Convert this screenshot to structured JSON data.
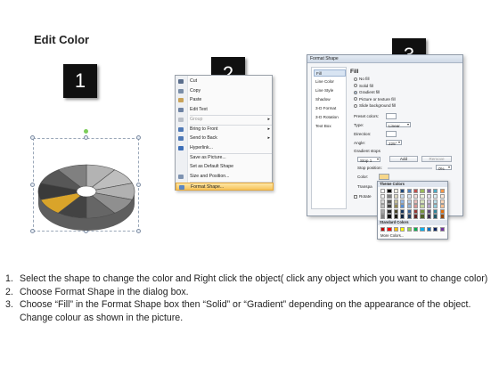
{
  "title": "Edit Color",
  "steps": [
    "1",
    "2",
    "3"
  ],
  "context_menu": {
    "items": [
      {
        "label": "Cut",
        "icon": "scissors-icon",
        "color": "#5a6e8c"
      },
      {
        "label": "Copy",
        "icon": "copy-icon",
        "color": "#7a8ea8"
      },
      {
        "label": "Paste",
        "icon": "paste-icon",
        "color": "#c9a35a"
      },
      {
        "label": "Edit Text",
        "icon": "edit-text-icon",
        "color": "#6d82a3"
      },
      {
        "label": "Group",
        "icon": "group-icon",
        "color": "#b9bfc8",
        "disabled": true,
        "submenu": true
      },
      {
        "label": "Bring to Front",
        "icon": "bring-front-icon",
        "color": "#4f79b6",
        "submenu": true
      },
      {
        "label": "Send to Back",
        "icon": "send-back-icon",
        "color": "#4f79b6",
        "submenu": true
      },
      {
        "label": "Hyperlink...",
        "icon": "hyperlink-icon",
        "color": "#3d6fb8"
      },
      {
        "label": "Save as Picture...",
        "icon": "",
        "color": ""
      },
      {
        "label": "Set as Default Shape",
        "icon": "",
        "color": ""
      },
      {
        "label": "Size and Position...",
        "icon": "size-position-icon",
        "color": "#7e93b0"
      },
      {
        "label": "Format Shape...",
        "icon": "format-shape-icon",
        "color": "#5d86c2",
        "highlighted": true
      }
    ]
  },
  "dialog": {
    "title": "Format Shape",
    "nav": [
      "Fill",
      "Line Color",
      "Line Style",
      "Shadow",
      "3-D Format",
      "3-D Rotation",
      "Text Box"
    ],
    "fill_header": "Fill",
    "radios": [
      "No fill",
      "Solid fill",
      "Gradient fill",
      "Picture or texture fill",
      "Slide background fill"
    ],
    "preset_label": "Preset colors:",
    "type_label": "Type:",
    "type_value": "Linear",
    "direction_label": "Direction:",
    "angle_label": "Angle:",
    "angle_value": "225°",
    "gradient_stops_label": "Gradient stops",
    "stop_value": "Stop 1",
    "add_label": "Add",
    "remove_label": "Remove",
    "stop_position_label": "Stop position:",
    "stop_position_value": "0%",
    "color_label": "Color:",
    "transparency_label": "Transpa",
    "rotate_label": "Rotate"
  },
  "palette": {
    "theme_label": "Theme Colors",
    "standard_label": "Standard Colors",
    "more_label": "More Colors...",
    "theme_top": [
      "#ffffff",
      "#000000",
      "#eeece1",
      "#1f497d",
      "#4f81bd",
      "#c0504d",
      "#9bbb59",
      "#8064a2",
      "#4bacc6",
      "#f79646"
    ],
    "shade_columns": [
      [
        "#f2f2f2",
        "#d9d9d9",
        "#bfbfbf",
        "#a6a6a6",
        "#808080"
      ],
      [
        "#7f7f7f",
        "#595959",
        "#3f3f3f",
        "#262626",
        "#0d0d0d"
      ],
      [
        "#ddd9c3",
        "#c4bd97",
        "#938953",
        "#494429",
        "#1d1b10"
      ],
      [
        "#c6d9f0",
        "#8db3e2",
        "#548dd4",
        "#17365d",
        "#0f243e"
      ],
      [
        "#dbe5f1",
        "#b8cce4",
        "#95b3d7",
        "#366092",
        "#244061"
      ],
      [
        "#f2dcdb",
        "#e5b9b7",
        "#d99694",
        "#953734",
        "#632423"
      ],
      [
        "#ebf1dd",
        "#d7e3bc",
        "#c3d69b",
        "#76923c",
        "#4f6128"
      ],
      [
        "#e5e0ec",
        "#ccc1d9",
        "#b2a2c7",
        "#5f497a",
        "#3f3151"
      ],
      [
        "#dbeef3",
        "#b7dde8",
        "#92cddc",
        "#31859b",
        "#205867"
      ],
      [
        "#fdeada",
        "#fbd5b5",
        "#fac08f",
        "#e36c09",
        "#974806"
      ]
    ],
    "standard": [
      "#c00000",
      "#ff0000",
      "#ffc000",
      "#ffff00",
      "#92d050",
      "#00b050",
      "#00b0f0",
      "#0070c0",
      "#002060",
      "#7030a0"
    ]
  },
  "wheel": {
    "segments": 10,
    "base_color": "#8c8c8c",
    "highlight_color": "#d9a42a"
  },
  "instructions": [
    {
      "num": "1.",
      "text": "Select the shape to change the color and Right click the object( click any object which you want to change color)"
    },
    {
      "num": "2.",
      "text": "Choose Format Shape in the dialog box."
    },
    {
      "num": "3.",
      "text": "Choose “Fill” in the Format Shape box then “Solid” or “Gradient” depending on the appearance of the object. Change colour as shown in the picture."
    }
  ]
}
